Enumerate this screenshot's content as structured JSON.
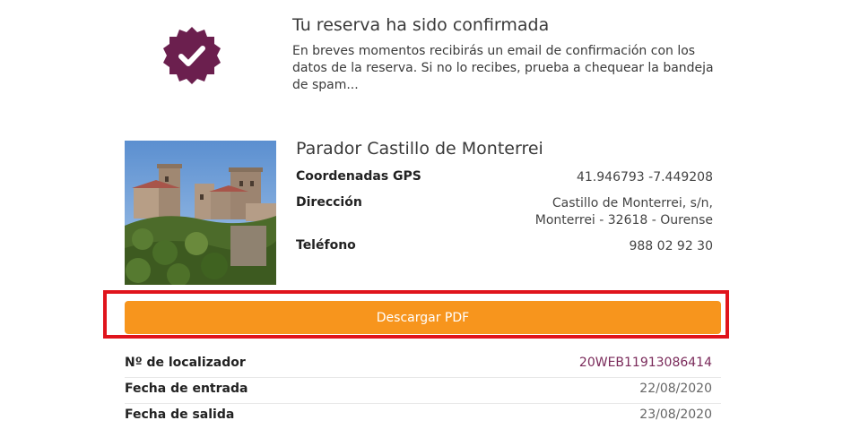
{
  "confirmation": {
    "title": "Tu reserva ha sido confirmada",
    "message": "En breves momentos recibirás un email de confirmación con los datos de la reserva. Si no lo recibes, prueba a chequear la bandeja de spam...",
    "badge_icon": "check-badge-icon",
    "badge_color": "#6b1f4e"
  },
  "hotel": {
    "name": "Parador Castillo de Monterrei",
    "photo_icon": "castle-photo",
    "gps_label": "Coordenadas GPS",
    "gps_value": "41.946793 -7.449208",
    "address_label": "Dirección",
    "address_line1": "Castillo de Monterrei, s/n,",
    "address_line2": "Monterrei - 32618 - Ourense",
    "phone_label": "Teléfono",
    "phone_value": "988 02 92 30"
  },
  "download": {
    "label": "Descargar PDF",
    "color": "#f7951d",
    "highlight_color": "#e0141c"
  },
  "details": [
    {
      "label": "Nº de localizador",
      "value": "20WEB11913086414"
    },
    {
      "label": "Fecha de entrada",
      "value": "22/08/2020"
    },
    {
      "label": "Fecha de salida",
      "value": "23/08/2020"
    }
  ]
}
